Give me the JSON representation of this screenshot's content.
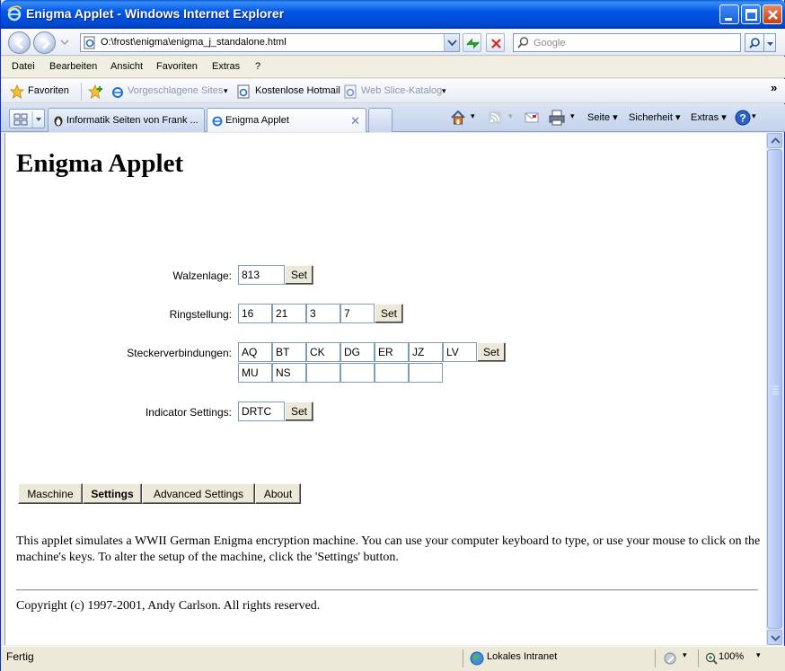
{
  "window": {
    "title": "Enigma Applet - Windows Internet Explorer"
  },
  "address_bar": {
    "url": "O:\\frost\\enigma\\enigma_j_standalone.html",
    "search_placeholder": "Google"
  },
  "menu": [
    "Datei",
    "Bearbeiten",
    "Ansicht",
    "Favoriten",
    "Extras",
    "?"
  ],
  "favorites_bar": {
    "favorites_label": "Favoriten",
    "items": [
      "Vorgeschlagene Sites",
      "Kostenlose Hotmail",
      "Web Slice-Katalog"
    ]
  },
  "tabs": [
    {
      "label": "Informatik Seiten von Frank ...",
      "active": false
    },
    {
      "label": "Enigma Applet",
      "active": true
    }
  ],
  "command_bar": {
    "seite": "Seite",
    "sicherheit": "Sicherheit",
    "extras": "Extras"
  },
  "page": {
    "title": "Enigma Applet",
    "walzenlage": {
      "label": "Walzenlage:",
      "value": "813"
    },
    "ringstellung": {
      "label": "Ringstellung:",
      "values": [
        "16",
        "21",
        "3",
        "7"
      ]
    },
    "steckerverbindungen": {
      "label": "Steckerverbindungen:",
      "values": [
        "AQ",
        "BT",
        "CK",
        "DG",
        "ER",
        "JZ",
        "LV",
        "MU",
        "NS",
        "",
        "",
        "",
        "",
        ""
      ]
    },
    "indicator": {
      "label": "Indicator Settings:",
      "value": "DRTC"
    },
    "set_label": "Set",
    "tab_buttons": [
      {
        "label": "Maschine",
        "active": false
      },
      {
        "label": "Settings",
        "active": true
      },
      {
        "label": "Advanced Settings",
        "active": false
      },
      {
        "label": "About",
        "active": false
      }
    ],
    "description": "This applet simulates a WWII German Enigma encryption machine. You can use your computer keyboard to type, or use your mouse to click on the machine's keys. To alter the setup of the machine, click the 'Settings' button.",
    "copyright": "Copyright (c) 1997-2001, Andy Carlson. All rights reserved."
  },
  "status_bar": {
    "status": "Fertig",
    "zone": "Lokales Intranet",
    "zoom": "100%"
  },
  "colors": {
    "titlebar": "#0058e6",
    "chrome": "#ece9d8",
    "input_border": "#7f9db9"
  }
}
